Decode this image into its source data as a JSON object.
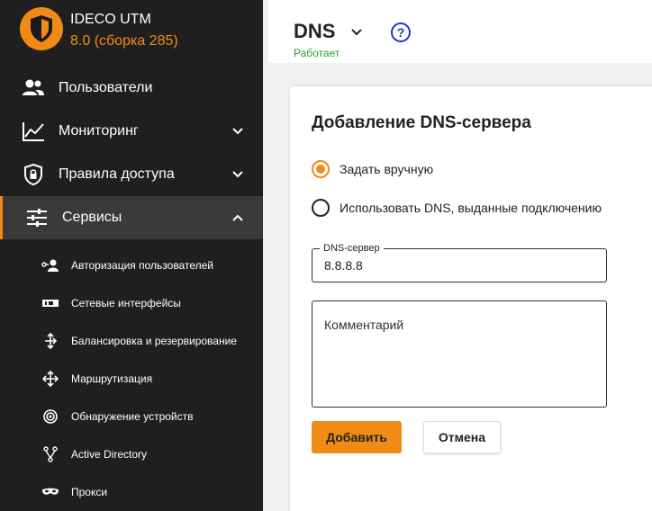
{
  "brand": {
    "name": "IDECO UTM",
    "version": "8.0 (сборка 285)"
  },
  "sidebar": {
    "items": [
      {
        "label": "Пользователи"
      },
      {
        "label": "Мониторинг"
      },
      {
        "label": "Правила доступа"
      },
      {
        "label": "Сервисы"
      }
    ],
    "subitems": [
      {
        "label": "Авторизация пользователей"
      },
      {
        "label": "Сетевые интерфейсы"
      },
      {
        "label": "Балансировка и резервирование"
      },
      {
        "label": "Маршрутизация"
      },
      {
        "label": "Обнаружение устройств"
      },
      {
        "label": "Active Directory"
      },
      {
        "label": "Прокси"
      }
    ]
  },
  "header": {
    "title": "DNS",
    "status": "Работает",
    "help_glyph": "?"
  },
  "form": {
    "title": "Добавление DNS-сервера",
    "radio_manual": "Задать вручную",
    "radio_auto": "Использовать DNS, выданные подключению",
    "dns_label": "DNS-сервер",
    "dns_value": "8.8.8.8",
    "comment_placeholder": "Комментарий",
    "add_button": "Добавить",
    "cancel_button": "Отмена"
  },
  "colors": {
    "accent": "#f08c16",
    "sidebar_bg": "#1f1f1f",
    "status_green": "#2f9e31",
    "help_blue": "#2433d6"
  }
}
